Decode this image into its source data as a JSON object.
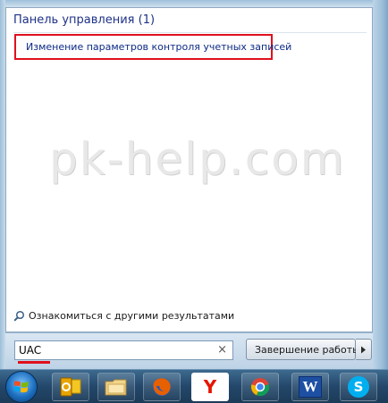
{
  "results": {
    "group_header": "Панель управления (1)",
    "items": [
      {
        "label": "Изменение параметров контроля учетных записей",
        "icon": "uac-flag-icon"
      }
    ]
  },
  "watermark": "pk-help.com",
  "more_results": {
    "label": "Ознакомиться с другими результатами",
    "icon": "search-icon"
  },
  "search": {
    "value": "UAC",
    "clear_glyph": "×"
  },
  "shutdown": {
    "label": "Завершение работы",
    "icon": "uac-shield-icon",
    "arrow_icon": "triangle-right-icon"
  },
  "highlight_color": "#e0101c",
  "taskbar": {
    "start_icon": "windows-start-orb-icon",
    "apps": [
      {
        "name": "outlook",
        "icon": "outlook-icon"
      },
      {
        "name": "explorer",
        "icon": "folder-icon"
      },
      {
        "name": "firefox",
        "icon": "firefox-icon"
      },
      {
        "name": "yandex",
        "icon": "yandex-icon",
        "glyph": "Y"
      },
      {
        "name": "chrome",
        "icon": "chrome-icon"
      },
      {
        "name": "word",
        "icon": "word-icon",
        "glyph": "W"
      },
      {
        "name": "skype",
        "icon": "skype-icon",
        "glyph": "S"
      }
    ]
  }
}
